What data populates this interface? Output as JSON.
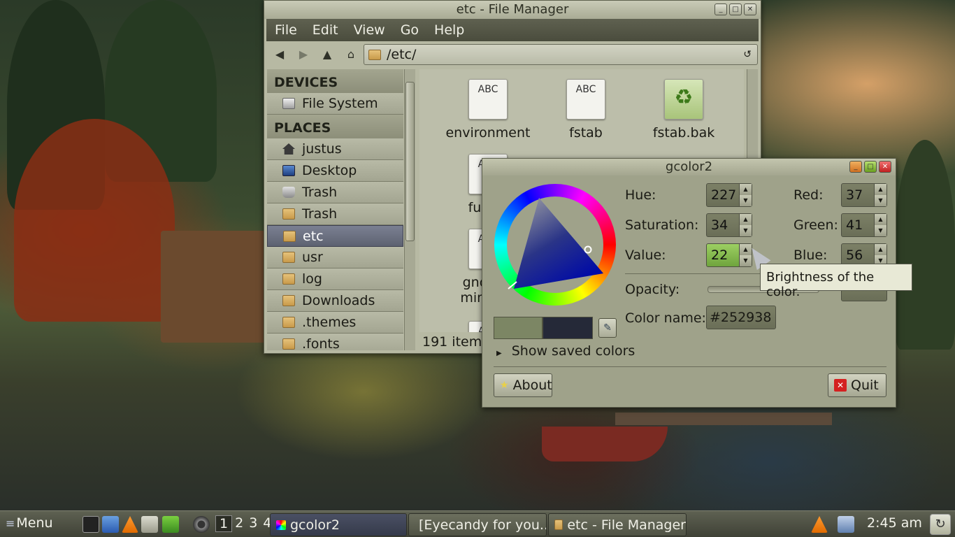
{
  "file_manager": {
    "title": "etc - File Manager",
    "menu": [
      "File",
      "Edit",
      "View",
      "Go",
      "Help"
    ],
    "path": "/etc/",
    "sidebar": {
      "devices_header": "DEVICES",
      "devices": [
        {
          "label": "File System",
          "icon": "drive-icon"
        }
      ],
      "places_header": "PLACES",
      "places": [
        {
          "label": "justus",
          "icon": "home-icon"
        },
        {
          "label": "Desktop",
          "icon": "desktop-icon"
        },
        {
          "label": "Trash",
          "icon": "trash-icon"
        },
        {
          "label": "Trash",
          "icon": "folder-icon"
        },
        {
          "label": "etc",
          "icon": "folder-icon",
          "selected": true
        },
        {
          "label": "usr",
          "icon": "folder-icon"
        },
        {
          "label": "log",
          "icon": "folder-icon"
        },
        {
          "label": "Downloads",
          "icon": "folder-icon"
        },
        {
          "label": ".themes",
          "icon": "folder-icon"
        },
        {
          "label": ".fonts",
          "icon": "folder-icon"
        }
      ]
    },
    "files": [
      {
        "name": "environment",
        "icon_text": "ABC"
      },
      {
        "name": "fstab",
        "icon_text": "ABC"
      },
      {
        "name": "fstab.bak",
        "icon": "recycle-icon"
      },
      {
        "name": "fuse.c",
        "icon_text": "ABC"
      },
      {
        "name": "gnome-",
        "name2": "mime-m",
        "icon_text": "ABC"
      },
      {
        "name": "",
        "icon_text": "ABC"
      }
    ],
    "status": "191 items"
  },
  "gcolor2": {
    "title": "gcolor2",
    "hue_label": "Hue:",
    "hue": "227",
    "saturation_label": "Saturation:",
    "saturation": "34",
    "value_label": "Value:",
    "value": "22",
    "red_label": "Red:",
    "red": "37",
    "green_label": "Green:",
    "green": "41",
    "blue_label": "Blue:",
    "blue": "56",
    "opacity_label": "Opacity:",
    "color_name_label": "Color name:",
    "color_name": "#252938",
    "show_saved": "Show saved colors",
    "about_label": "About",
    "quit_label": "Quit",
    "tooltip": "Brightness of the color.",
    "current_color": "#252938"
  },
  "taskbar": {
    "menu_label": "Menu",
    "workspaces": [
      "1",
      "2",
      "3",
      "4"
    ],
    "tasks": [
      {
        "label": "gcolor2",
        "active": true
      },
      {
        "label": "[Eyecandy for you..."
      },
      {
        "label": "etc - File Manager"
      }
    ],
    "clock": "2:45 am"
  }
}
